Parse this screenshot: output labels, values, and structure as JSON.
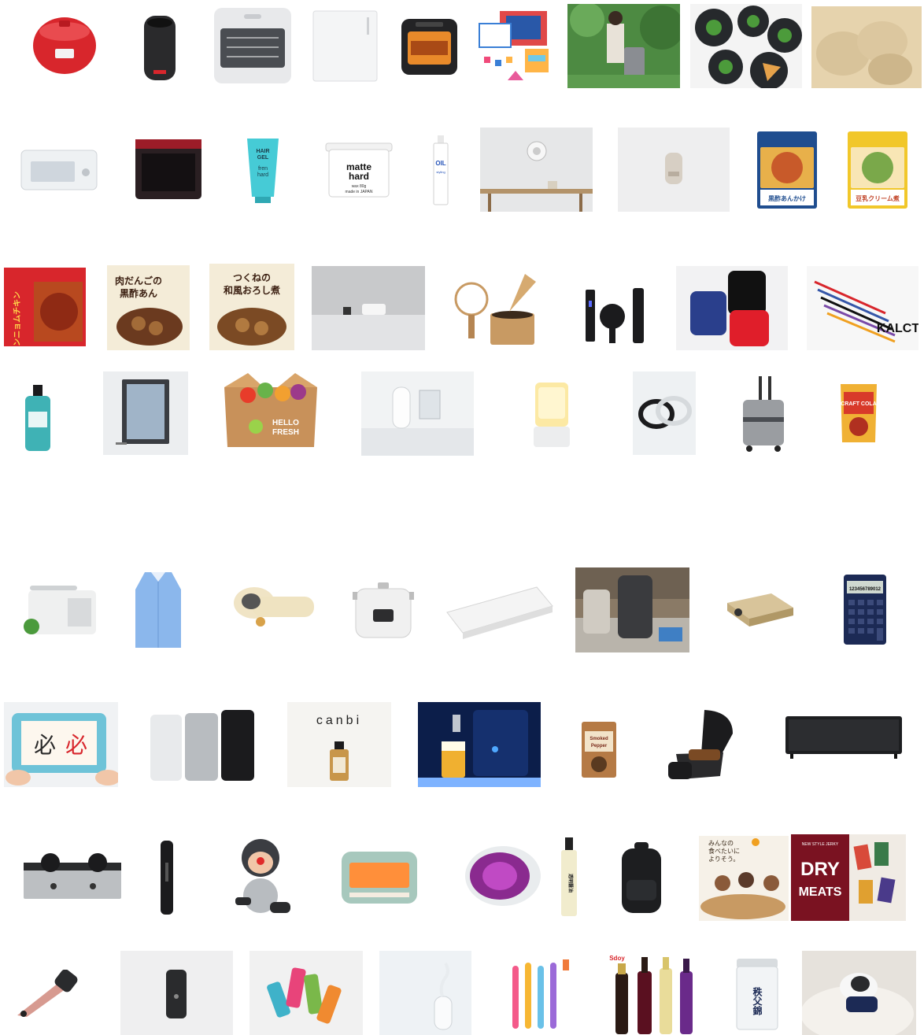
{
  "labels": {
    "hair_gel_1": "HAIR",
    "hair_gel_2": "GEL",
    "hair_gel_3": "fren",
    "hair_gel_4": "hard",
    "matte_1": "matte",
    "matte_2": "hard",
    "matte_3": "wax 80g",
    "matte_4": "made in JAPAN",
    "oil_1": "OIL",
    "oil_2": "styling",
    "pack_a": "黒酢あんかけ",
    "pack_b": "豆乳クリーム煮",
    "yangnyeom": "ヤンニョムチキン",
    "niku_1": "肉だんごの",
    "niku_2": "黒酢あん",
    "tsukune_1": "つくねの",
    "tsukune_2": "和風おろし煮",
    "kalct": "KALCT",
    "hello_1": "HELLO",
    "hello_2": "FRESH",
    "craft_cola": "CRAFT COLA",
    "calc_display": "123456789012",
    "canbi": "canbi",
    "smoked_1": "Smoked",
    "smoked_2": "Pepper",
    "kanji_a": "必",
    "kanji_b": "必",
    "soy": "透明醤油",
    "ad_1": "みんなの",
    "ad_2": "食べたいに",
    "ad_3": "よりそう。",
    "dry_small": "NEW STYLE JERKY",
    "dry_1": "DRY",
    "dry_2": "MEATS",
    "tea": "秩父錦",
    "wine_brand": "Sdoy"
  },
  "colors": {
    "red": "#d8262c",
    "black": "#1b1b1d",
    "teal": "#3fc9d6",
    "navy": "#1c2a55",
    "beige": "#e9dfcc",
    "wood": "#c89a63",
    "burgundy": "#7a1221"
  }
}
